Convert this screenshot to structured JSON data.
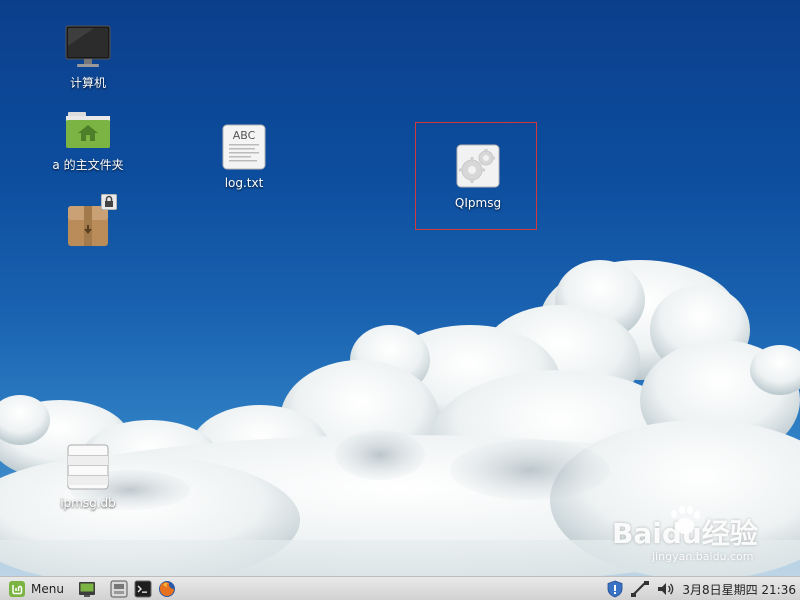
{
  "desktop": {
    "icons": {
      "computer": {
        "label": "计算机",
        "icon": "monitor-icon"
      },
      "home": {
        "label": "a 的主文件夹",
        "icon": "home-folder-icon"
      },
      "package": {
        "label": "",
        "icon": "package-box-icon"
      },
      "log": {
        "label": "log.txt",
        "icon": "text-file-icon",
        "preview_text": "ABC"
      },
      "qipmsg": {
        "label": "QIpmsg",
        "icon": "executable-gear-icon"
      },
      "ipmsgdb": {
        "label": "ipmsg.db",
        "icon": "database-icon"
      }
    },
    "watermark": {
      "main": "Baidu经验",
      "sub": "jingyan.baidu.com"
    }
  },
  "panel": {
    "menu_label": "Menu",
    "launchers": [
      "show-desktop-icon",
      "file-manager-icon",
      "terminal-icon",
      "firefox-icon"
    ],
    "tray_icons": [
      "shield-update-icon",
      "network-icon",
      "volume-icon"
    ],
    "clock": "3月8日星期四 21:36"
  },
  "colors": {
    "sky_top": "#0b3f8c",
    "selection_border": "#d23a3a",
    "panel_bg": "#dcdcdc",
    "mint_green": "#7bb442"
  }
}
